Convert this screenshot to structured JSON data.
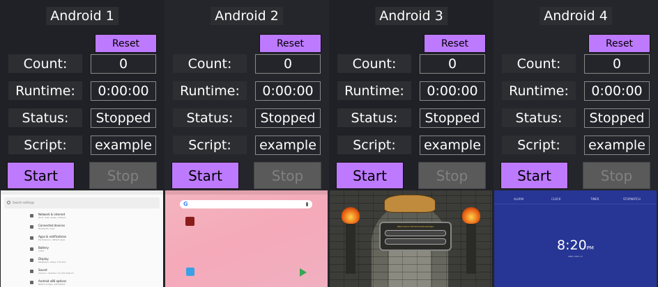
{
  "labels": {
    "count": "Count:",
    "runtime": "Runtime:",
    "status": "Status:",
    "script": "Script:"
  },
  "buttons": {
    "reset": "Reset",
    "start": "Start",
    "stop": "Stop"
  },
  "colors": {
    "accent": "#bd7aff",
    "disabled": "#5a5a5a",
    "background": "#1f2023"
  },
  "devices": [
    {
      "title": "Android 1",
      "count": "0",
      "runtime": "0:00:00",
      "status": "Stopped",
      "script": "example",
      "screen": "settings"
    },
    {
      "title": "Android 2",
      "count": "0",
      "runtime": "0:00:00",
      "status": "Stopped",
      "script": "example",
      "screen": "home"
    },
    {
      "title": "Android 3",
      "count": "0",
      "runtime": "0:00:00",
      "status": "Stopped",
      "script": "example",
      "screen": "game-login"
    },
    {
      "title": "Android 4",
      "count": "0",
      "runtime": "0:00:00",
      "status": "Stopped",
      "script": "example",
      "screen": "clock"
    }
  ],
  "screens": {
    "settings": {
      "search_placeholder": "Search settings",
      "items": [
        {
          "title": "Network & internet",
          "subtitle": "Wi-Fi, data usage, hotspot"
        },
        {
          "title": "Connected devices",
          "subtitle": "Bluetooth, Cast"
        },
        {
          "title": "Apps & notifications",
          "subtitle": "Permissions, default apps"
        },
        {
          "title": "Battery",
          "subtitle": "100%"
        },
        {
          "title": "Display",
          "subtitle": "Wallpaper, sleep, font size"
        },
        {
          "title": "Sound",
          "subtitle": "Volume, vibration, Do Not Disturb"
        },
        {
          "title": "Android x86 options",
          "subtitle": "Native bridge, autodetect"
        }
      ]
    },
    "home": {
      "search_logo": "G"
    },
    "game": {
      "welcome": "Welcome to Old School RuneScape",
      "google": "Sign in with Google",
      "email": "Sign in with Email / Username"
    },
    "clock": {
      "tabs": [
        "ALARM",
        "CLOCK",
        "TIMER",
        "STOPWATCH"
      ],
      "time": "8:20",
      "ampm": "PM",
      "date": "WED, NOV 13"
    }
  }
}
